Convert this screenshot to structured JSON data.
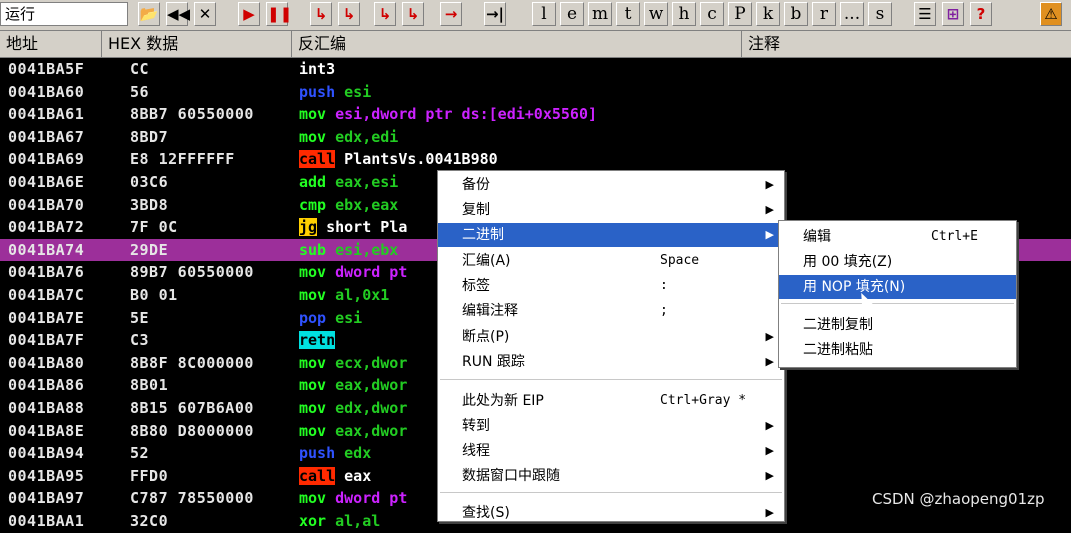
{
  "toolbar": {
    "run_label": "运行",
    "buttons": [
      "▶",
      "◀◀",
      "✕",
      "▶",
      "❚❚",
      "↳",
      "↳",
      "↳",
      "↳",
      "→",
      "→|"
    ],
    "letters": [
      "l",
      "e",
      "m",
      "t",
      "w",
      "h",
      "c",
      "P",
      "k",
      "b",
      "r",
      "...",
      "s"
    ],
    "tail": [
      "☰",
      "⊞",
      "?",
      "⚠"
    ]
  },
  "columns": {
    "address": "地址",
    "hex": "HEX 数据",
    "disasm": "反汇编",
    "comment": "注释"
  },
  "rows": [
    {
      "addr": "0041BA5F",
      "hex": "CC",
      "mn": "int3",
      "ops": ""
    },
    {
      "addr": "0041BA60",
      "hex": "56",
      "mn": "push",
      "ops": "esi"
    },
    {
      "addr": "0041BA61",
      "hex": "8BB7 60550000",
      "mn": "mov",
      "ops": "esi,dword ptr ds:[edi+0x5560]"
    },
    {
      "addr": "0041BA67",
      "hex": "8BD7",
      "mn": "mov",
      "ops": "edx,edi"
    },
    {
      "addr": "0041BA69",
      "hex": "E8 12FFFFFF",
      "mn": "call",
      "ops": "PlantsVs.0041B980"
    },
    {
      "addr": "0041BA6E",
      "hex": "03C6",
      "mn": "add",
      "ops": "eax,esi"
    },
    {
      "addr": "0041BA70",
      "hex": "3BD8",
      "mn": "cmp",
      "ops": "ebx,eax"
    },
    {
      "addr": "0041BA72",
      "hex": "7F 0C",
      "mn": "jg",
      "ops": "short Pla"
    },
    {
      "addr": "0041BA74",
      "hex": "29DE",
      "mn": "sub",
      "ops": "esi,ebx"
    },
    {
      "addr": "0041BA76",
      "hex": "89B7 60550000",
      "mn": "mov",
      "ops": "dword pt"
    },
    {
      "addr": "0041BA7C",
      "hex": "B0 01",
      "mn": "mov",
      "ops": "al,0x1"
    },
    {
      "addr": "0041BA7E",
      "hex": "5E",
      "mn": "pop",
      "ops": "esi"
    },
    {
      "addr": "0041BA7F",
      "hex": "C3",
      "mn": "retn",
      "ops": ""
    },
    {
      "addr": "0041BA80",
      "hex": "8B8F 8C000000",
      "mn": "mov",
      "ops": "ecx,dwor"
    },
    {
      "addr": "0041BA86",
      "hex": "8B01",
      "mn": "mov",
      "ops": "eax,dwor"
    },
    {
      "addr": "0041BA88",
      "hex": "8B15 607B6A00",
      "mn": "mov",
      "ops": "edx,dwor"
    },
    {
      "addr": "0041BA8E",
      "hex": "8B80 D8000000",
      "mn": "mov",
      "ops": "eax,dwor"
    },
    {
      "addr": "0041BA94",
      "hex": "52",
      "mn": "push",
      "ops": "edx"
    },
    {
      "addr": "0041BA95",
      "hex": "FFD0",
      "mn": "call",
      "ops": "eax"
    },
    {
      "addr": "0041BA97",
      "hex": "C787 78550000",
      "mn": "mov",
      "ops": "dword pt"
    },
    {
      "addr": "0041BAA1",
      "hex": "32C0",
      "mn": "xor",
      "ops": "al,al"
    }
  ],
  "context_menu": {
    "items": [
      {
        "label": "备份",
        "shortcut": "",
        "arrow": "▶"
      },
      {
        "label": "复制",
        "shortcut": "",
        "arrow": "▶"
      },
      {
        "label": "二进制",
        "shortcut": "",
        "arrow": "▶"
      },
      {
        "label": "汇编(A)",
        "shortcut": "Space",
        "arrow": ""
      },
      {
        "label": "标签",
        "shortcut": ":",
        "arrow": ""
      },
      {
        "label": "编辑注释",
        "shortcut": ";",
        "arrow": ""
      },
      {
        "label": "断点(P)",
        "shortcut": "",
        "arrow": "▶"
      },
      {
        "label": "RUN 跟踪",
        "shortcut": "",
        "arrow": "▶"
      },
      {
        "label": "此处为新 EIP",
        "shortcut": "Ctrl+Gray *",
        "arrow": ""
      },
      {
        "label": "转到",
        "shortcut": "",
        "arrow": "▶"
      },
      {
        "label": "线程",
        "shortcut": "",
        "arrow": "▶"
      },
      {
        "label": "数据窗口中跟随",
        "shortcut": "",
        "arrow": "▶"
      },
      {
        "label": "查找(S)",
        "shortcut": "",
        "arrow": "▶"
      }
    ]
  },
  "submenu": {
    "items": [
      {
        "label": "编辑",
        "shortcut": "Ctrl+E"
      },
      {
        "label": "用 00 填充(Z)",
        "shortcut": ""
      },
      {
        "label": "用 NOP 填充(N)",
        "shortcut": ""
      },
      {
        "label": "二进制复制",
        "shortcut": ""
      },
      {
        "label": "二进制粘贴",
        "shortcut": ""
      }
    ]
  },
  "watermark": "CSDN @zhaopeng01zp",
  "colors": {
    "selection": "#9c2f9a",
    "menu_highlight": "#2a62c7",
    "push_pop": "#2f52ff",
    "call": "#ff2a00",
    "retn": "#00e0e0",
    "jump": "#ffd000"
  }
}
